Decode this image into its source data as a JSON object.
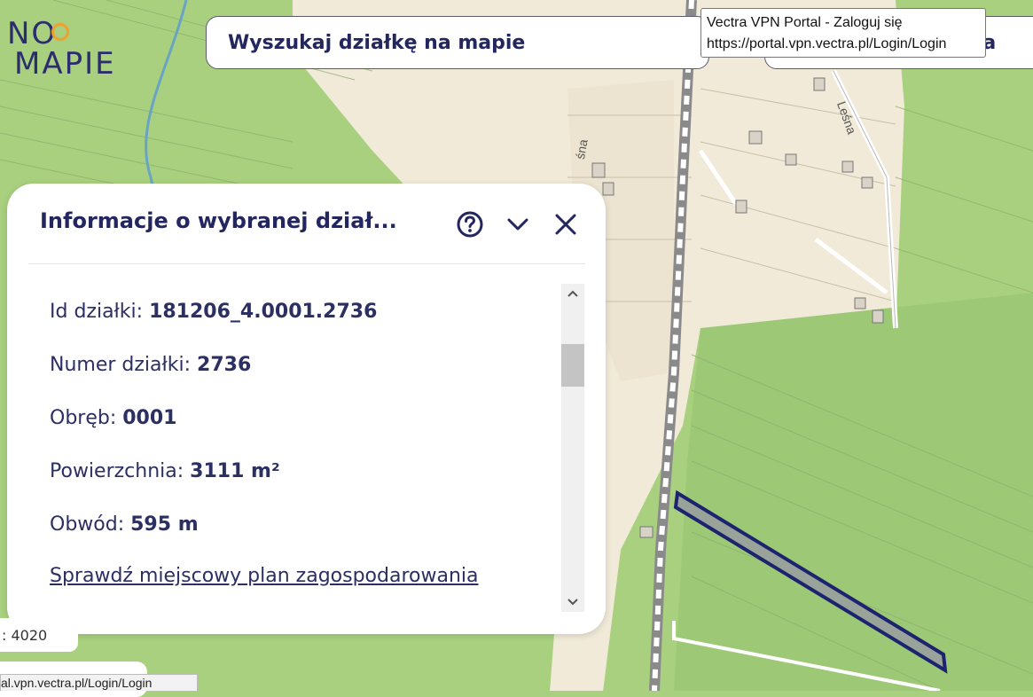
{
  "logo": {
    "line1": "NO",
    "line2": "MAPIE"
  },
  "search": {
    "placeholder": "Wyszukaj działkę na mapie",
    "second_partial": "a ma"
  },
  "tooltip": {
    "line1": "Vectra VPN Portal - Zaloguj się",
    "line2": "https://portal.vpn.vectra.pl/Login/Login"
  },
  "map": {
    "street_lesna": "Leśna",
    "street_lesna_partial": "śna"
  },
  "panel": {
    "title": "Informacje o wybranej dział...",
    "rows": [
      {
        "label": "Id działki: ",
        "value": "181206_4.0001.2736"
      },
      {
        "label": "Numer działki: ",
        "value": "2736"
      },
      {
        "label": "Obręb: ",
        "value": "0001"
      },
      {
        "label": "Powierzchnia: ",
        "value": "3111 m²"
      },
      {
        "label": "Obwód: ",
        "value": "595 m"
      }
    ],
    "link": "Sprawdź miejscowy plan zagospodarowania"
  },
  "scale": {
    "text": ": 4020"
  },
  "status": {
    "url": "al.vpn.vectra.pl/Login/Login"
  },
  "colors": {
    "accent": "#23265f",
    "map_green": "#a9d07f",
    "plot_outline": "#1c2470"
  }
}
